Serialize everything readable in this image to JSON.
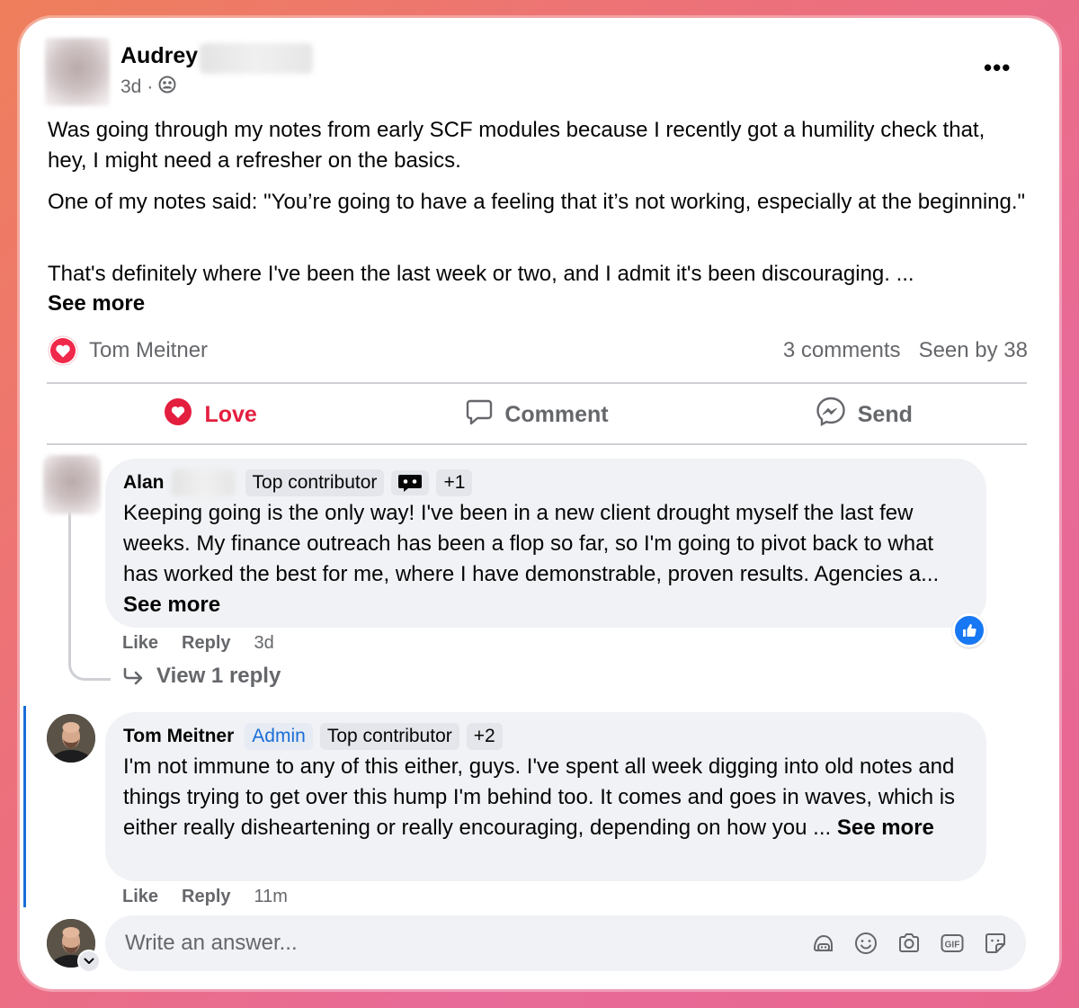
{
  "post": {
    "author": "Audrey",
    "time": "3d",
    "separator": "·",
    "privacy_icon": "group-icon",
    "paragraphs": [
      "Was going through my notes from early SCF modules because I recently got a humility check that, hey, I might need a refresher on the basics.",
      "One of my notes said: \"You’re going to have a feeling that it’s not working, especially at the beginning.\"",
      "That's definitely where I've been the last week or two, and I admit it's been discouraging. ..."
    ],
    "see_more": "See more",
    "reaction_name": "Tom Meitner",
    "comments_count": "3 comments",
    "seen_by": "Seen by 38"
  },
  "actions": {
    "love": "Love",
    "comment": "Comment",
    "send": "Send"
  },
  "comments": [
    {
      "name": "Alan",
      "badges": [
        "Top contributor"
      ],
      "extra": "+1",
      "text": "Keeping going is the only way! I've been in a new client drought myself the last few weeks. My finance outreach has been a flop so far, so I'm going to pivot back to what has worked the best for me, where I have demonstrable, proven results. Agencies a...",
      "see_more": "See more",
      "like": "Like",
      "reply": "Reply",
      "time": "3d",
      "view_replies": "View 1 reply"
    },
    {
      "name": "Tom Meitner",
      "admin": "Admin",
      "badges": [
        "Top contributor"
      ],
      "extra": "+2",
      "text": "I'm not immune to any of this either, guys. I've spent all week digging into old notes and things trying to get over this hump I'm behind too. It comes and goes in waves, which is either really disheartening or really encouraging, depending on how you ...",
      "see_more": "See more",
      "like": "Like",
      "reply": "Reply",
      "time": "11m"
    }
  ],
  "composer": {
    "placeholder": "Write an answer..."
  },
  "colors": {
    "love": "#e41e3f",
    "admin": "#1a6ed8",
    "like_badge": "#1877f2",
    "muted": "#65676b",
    "bubble": "#f0f2f5"
  }
}
